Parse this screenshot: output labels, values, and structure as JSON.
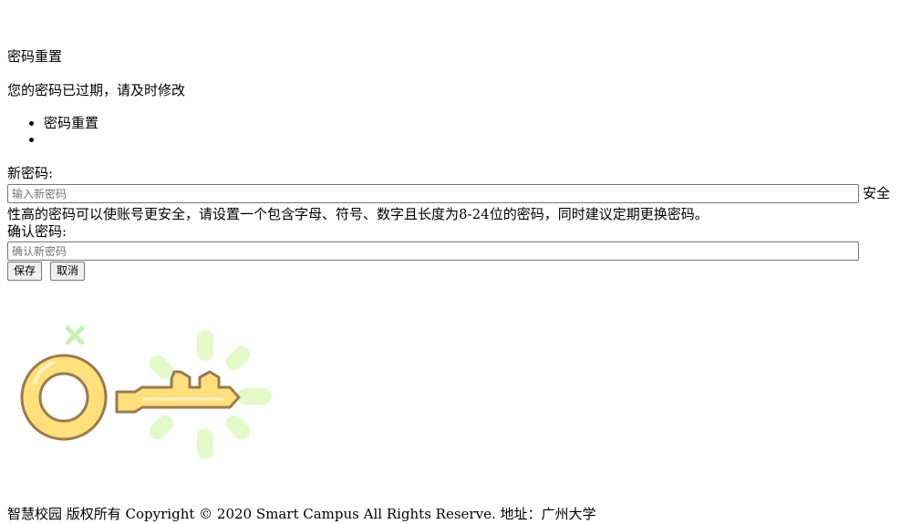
{
  "page": {
    "title": "密码重置",
    "subtitle": "您的密码已过期，请及时修改"
  },
  "tabs": [
    {
      "label": "密码重置"
    },
    {
      "label": ""
    }
  ],
  "form": {
    "new_password_label": "新密码:",
    "new_password_placeholder": "输入新密码",
    "new_password_value": "",
    "hint_part1": "安全",
    "hint_part2": "性高的密码可以使账号更安全，请设置一个包含字母、符号、数字且长度为8-24位的密码，同时建议定期更换密码。",
    "confirm_password_label": "确认密码:",
    "confirm_password_placeholder": "确认新密码",
    "confirm_password_value": "",
    "save_label": "保存",
    "cancel_label": "取消"
  },
  "illustration": {
    "icon": "key-icon",
    "colors": {
      "key_fill": "#FFE07A",
      "key_stroke": "#9A7A4E",
      "sparkle": "#E3F9C8",
      "cross": "#C9F0B0"
    }
  },
  "footer": {
    "text": "智慧校园 版权所有 Copyright © 2020 Smart Campus All Rights Reserve. 地址：广州大学"
  }
}
